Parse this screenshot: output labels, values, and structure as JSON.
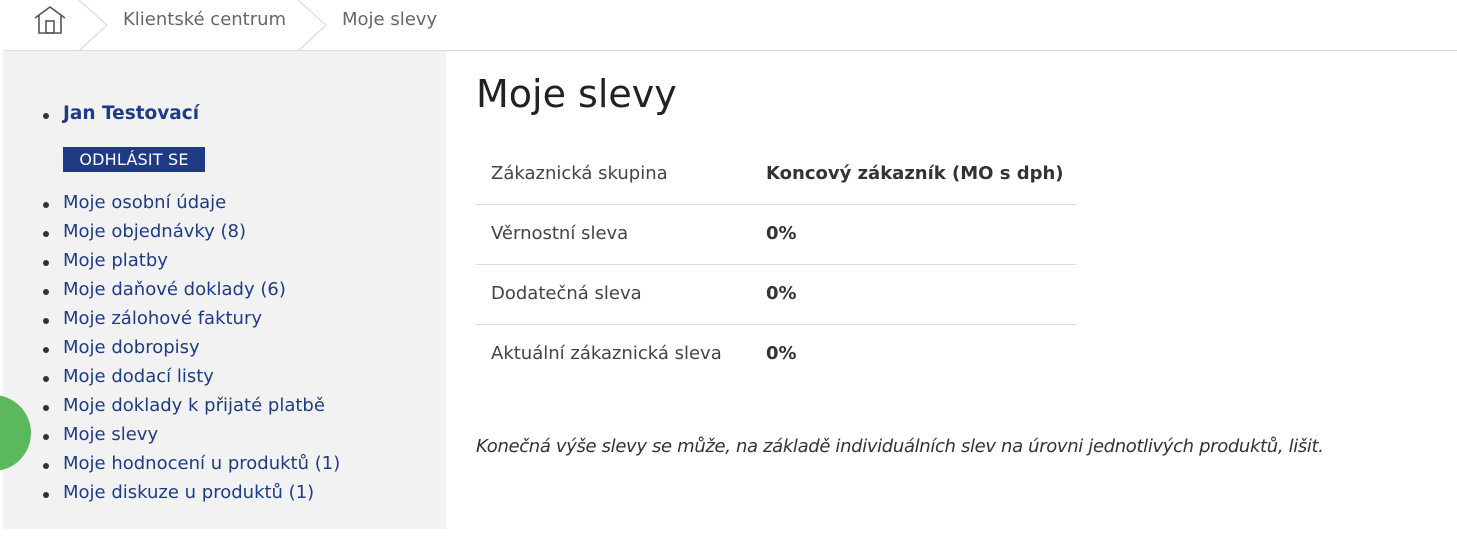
{
  "breadcrumb": {
    "home_icon": "home-icon",
    "items": [
      "Klientské centrum",
      "Moje slevy"
    ]
  },
  "sidebar": {
    "user_name": "Jan Testovací",
    "logout_label": "ODHLÁSIT SE",
    "items": [
      {
        "label": "Moje osobní údaje"
      },
      {
        "label": "Moje objednávky (8)"
      },
      {
        "label": "Moje platby"
      },
      {
        "label": "Moje daňové doklady (6)"
      },
      {
        "label": "Moje zálohové faktury"
      },
      {
        "label": "Moje dobropisy"
      },
      {
        "label": "Moje dodací listy"
      },
      {
        "label": "Moje doklady k přijaté platbě"
      },
      {
        "label": "Moje slevy"
      },
      {
        "label": "Moje hodnocení u produktů (1)"
      },
      {
        "label": "Moje diskuze u produktů (1)"
      }
    ]
  },
  "main": {
    "title": "Moje slevy",
    "rows": [
      {
        "label": "Zákaznická skupina",
        "value": "Koncový zákazník (MO s dph)"
      },
      {
        "label": "Věrnostní sleva",
        "value": "0%"
      },
      {
        "label": "Dodatečná sleva",
        "value": "0%"
      },
      {
        "label": "Aktuální zákaznická sleva",
        "value": "0%"
      }
    ],
    "note": "Konečná výše slevy se může, na základě individuálních slev na úrovni jednotlivých produktů, lišit."
  },
  "colors": {
    "link": "#1f3b86",
    "button_bg": "#1f3b86",
    "sidebar_bg": "#f2f2f2",
    "chat_button": "#5cb85c"
  }
}
